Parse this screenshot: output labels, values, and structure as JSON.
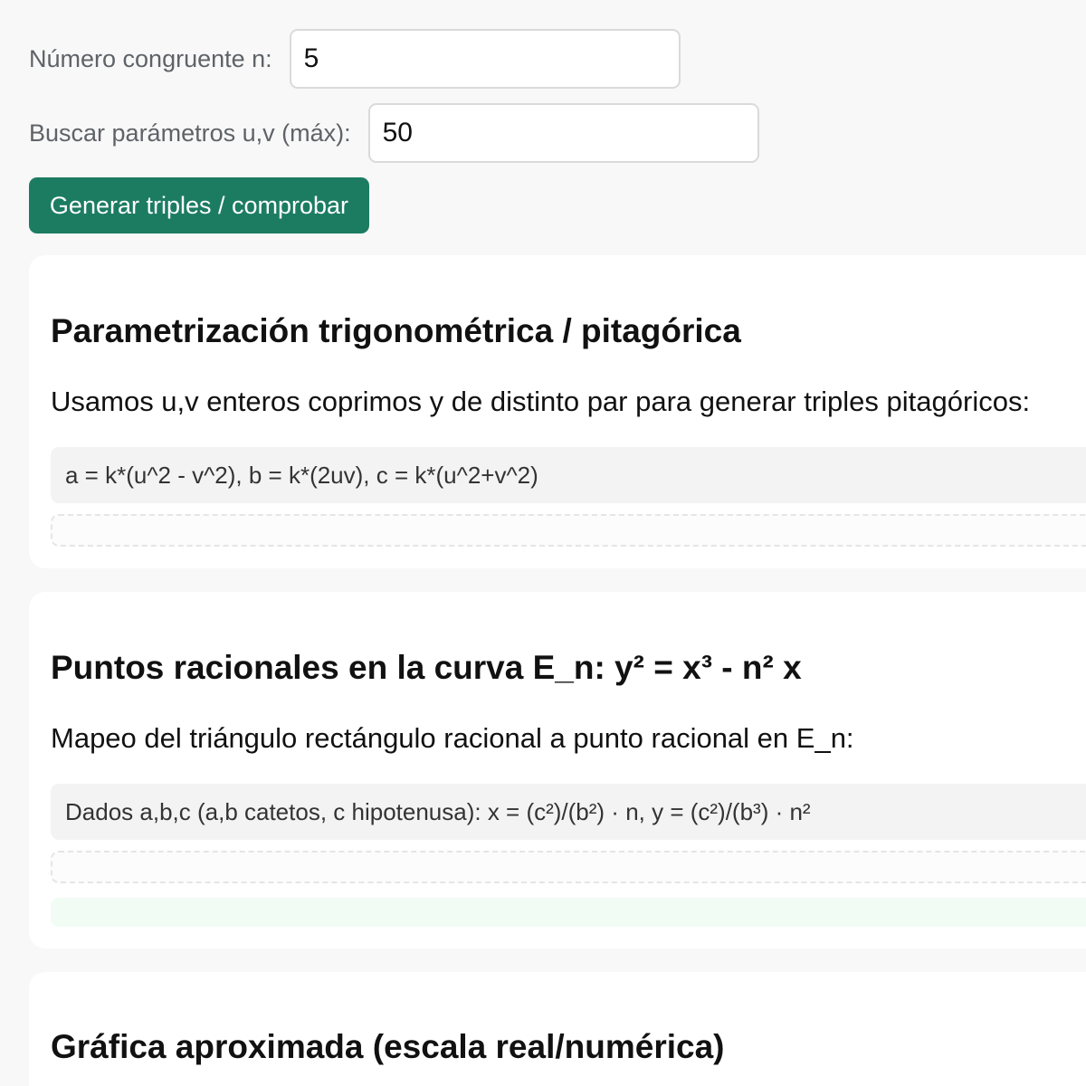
{
  "controls": {
    "n_label": "Número congruente n:",
    "n_value": "5",
    "uv_label": "Buscar parámetros u,v (máx):",
    "uv_value": "50",
    "generate_button": "Generar triples / comprobar"
  },
  "sections": {
    "parametrization": {
      "title": "Parametrización trigonométrica / pitagórica",
      "description": "Usamos u,v enteros coprimos y de distinto par para generar triples pitagóricos:",
      "formula": "a = k*(u^2 - v^2), b = k*(2uv), c = k*(u^2+v^2)"
    },
    "rational_points": {
      "title": "Puntos racionales en la curva E_n: y² = x³ - n² x",
      "description": "Mapeo del triángulo rectángulo racional a punto racional en E_n:",
      "formula": "Dados a,b,c (a,b catetos, c hipotenusa): x = (c²)/(b²) · n, y = (c²)/(b³) · n²"
    },
    "graph": {
      "title": "Gráfica aproximada (escala real/numérica)"
    }
  },
  "colors": {
    "page_background": "#f8f8f8",
    "card_background": "#ffffff",
    "accent": "#1c7c62",
    "formula_background": "#f3f3f3",
    "success_background": "#f1fcf4"
  }
}
